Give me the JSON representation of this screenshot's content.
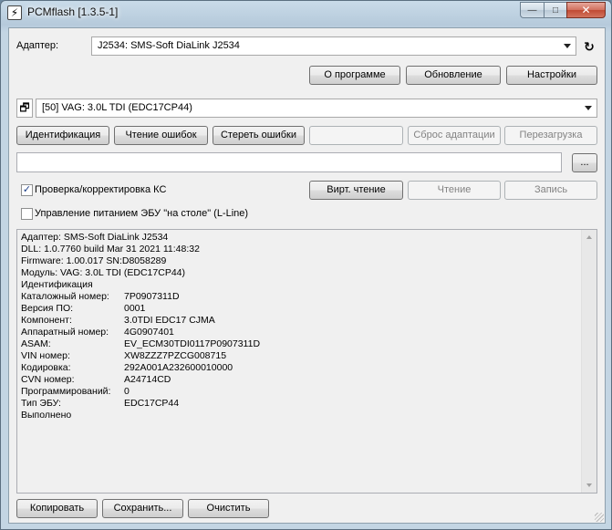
{
  "window": {
    "title": "PCMflash [1.3.5-1]",
    "app_icon_glyph": "⚡",
    "controls": {
      "minimize": "—",
      "maximize": "□",
      "close": "✕"
    }
  },
  "adapter": {
    "label": "Адаптер:",
    "selected": "J2534: SMS-Soft DiaLink J2534",
    "refresh_icon": "↻"
  },
  "top_buttons": {
    "about": "О программе",
    "update": "Обновление",
    "settings": "Настройки"
  },
  "module": {
    "icon_glyph": "🗗",
    "selected": "[50] VAG: 3.0L TDI (EDC17CP44)"
  },
  "action_buttons": {
    "identify": "Идентификация",
    "read_errors": "Чтение ошибок",
    "clear_errors": "Стереть ошибки",
    "blank": "",
    "reset_adapt": "Сброс адаптации",
    "reboot": "Перезагрузка"
  },
  "file": {
    "value": "",
    "browse": "..."
  },
  "options": {
    "checksum_label": "Проверка/корректировка КС",
    "checksum_checked": true,
    "power_label": "Управление питанием ЭБУ \"на столе\" (L-Line)",
    "power_checked": false
  },
  "rw_buttons": {
    "virt_read": "Вирт. чтение",
    "read": "Чтение",
    "write": "Запись"
  },
  "log": {
    "lines": [
      "Адаптер: SMS-Soft DiaLink J2534",
      "DLL: 1.0.7760 build Mar 31 2021 11:48:32",
      "Firmware: 1.00.017 SN:D8058289",
      "Модуль: VAG: 3.0L TDI (EDC17CP44)",
      "Идентификация"
    ],
    "pairs": [
      {
        "k": "Каталожный номер:",
        "v": "7P0907311D"
      },
      {
        "k": "Версия ПО:",
        "v": "0001"
      },
      {
        "k": "Компонент:",
        "v": "3.0TDI EDC17 CJMA"
      },
      {
        "k": "Аппаратный номер:",
        "v": "4G0907401"
      },
      {
        "k": "ASAM:",
        "v": "EV_ECM30TDI0117P0907311D"
      },
      {
        "k": "VIN номер:",
        "v": "XW8ZZZ7PZCG008715"
      },
      {
        "k": "Кодировка:",
        "v": "292A001A232600010000"
      },
      {
        "k": "CVN номер:",
        "v": "A24714CD"
      },
      {
        "k": "Программирований:",
        "v": "0"
      },
      {
        "k": "Тип ЭБУ:",
        "v": "EDC17CP44"
      }
    ],
    "footer": "Выполнено"
  },
  "bottom_buttons": {
    "copy": "Копировать",
    "save": "Сохранить...",
    "clear": "Очистить"
  }
}
